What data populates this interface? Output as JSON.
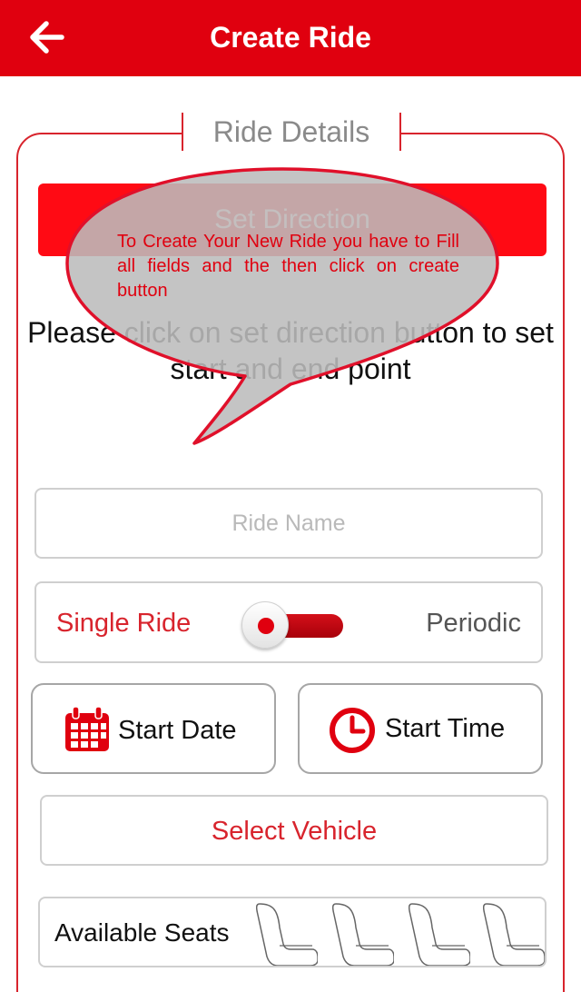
{
  "header": {
    "title": "Create Ride",
    "background_color": "#e0000f",
    "back_icon": "arrow-left-icon"
  },
  "ride_details": {
    "section_title": "Ride Details",
    "set_direction_label": "Set Direction",
    "instruction_text": "Please click on set direction button to set start and end point",
    "tooltip_text": "To Create Your New Ride you have to Fill all fields and the then click on create button"
  },
  "form": {
    "ride_name_placeholder": "Ride Name",
    "ride_name_value": "",
    "ride_type": {
      "left_label": "Single Ride",
      "right_label": "Periodic",
      "selected": "Single Ride"
    },
    "start_date_label": "Start Date",
    "start_date_icon": "calendar-icon",
    "start_time_label": "Start Time",
    "start_time_icon": "clock-icon",
    "select_vehicle_label": "Select Vehicle",
    "available_seats_label": "Available Seats",
    "seat_icon": "seat-icon",
    "seat_count": 4
  },
  "colors": {
    "accent": "#e0000f",
    "border": "#d8242d",
    "tooltip_fill": "#bcbcbc"
  }
}
